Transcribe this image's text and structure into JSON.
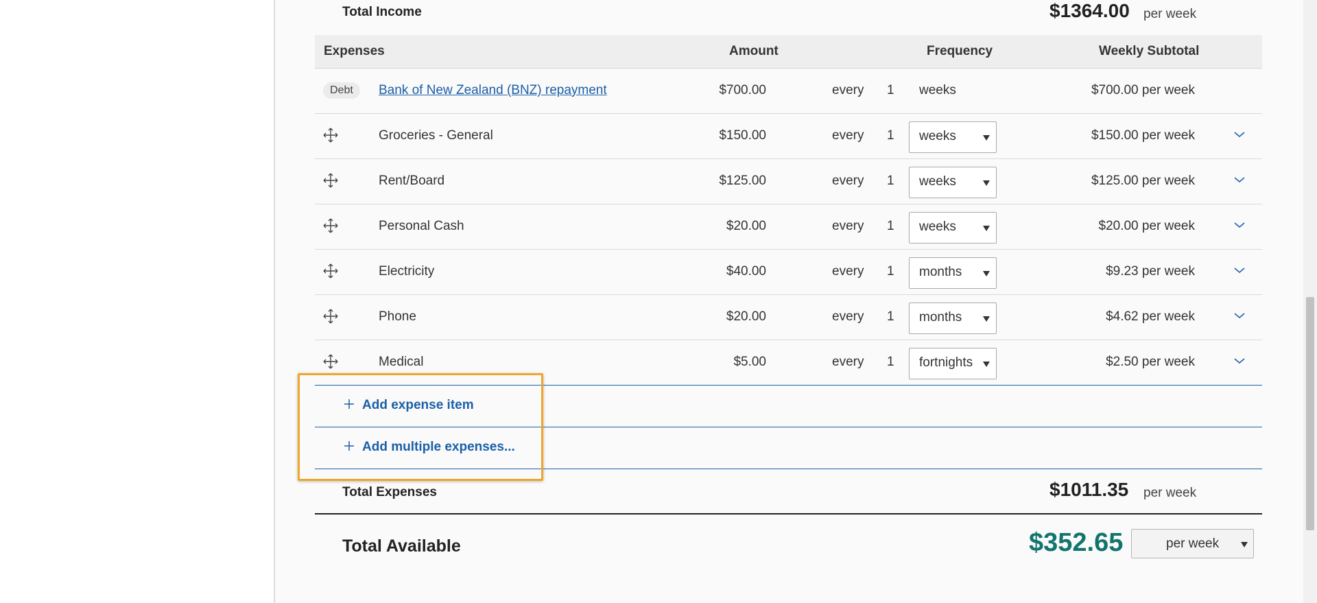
{
  "total_income": {
    "label": "Total Income",
    "amount": "$1364.00",
    "per": "per week"
  },
  "expenses_header": {
    "expenses": "Expenses",
    "amount": "Amount",
    "frequency": "Frequency",
    "weekly_subtotal": "Weekly Subtotal"
  },
  "expenses": [
    {
      "badge": "Debt",
      "name": "Bank of New Zealand (BNZ) repayment",
      "amount": "$700.00",
      "every": "every",
      "count": "1",
      "frequency": "weeks",
      "subtotal": "$700.00 per week",
      "editable": false
    },
    {
      "name": "Groceries - General",
      "amount": "$150.00",
      "every": "every",
      "count": "1",
      "frequency": "weeks",
      "subtotal": "$150.00 per week",
      "editable": true
    },
    {
      "name": "Rent/Board",
      "amount": "$125.00",
      "every": "every",
      "count": "1",
      "frequency": "weeks",
      "subtotal": "$125.00 per week",
      "editable": true
    },
    {
      "name": "Personal Cash",
      "amount": "$20.00",
      "every": "every",
      "count": "1",
      "frequency": "weeks",
      "subtotal": "$20.00 per week",
      "editable": true
    },
    {
      "name": "Electricity",
      "amount": "$40.00",
      "every": "every",
      "count": "1",
      "frequency": "months",
      "subtotal": "$9.23 per week",
      "editable": true
    },
    {
      "name": "Phone",
      "amount": "$20.00",
      "every": "every",
      "count": "1",
      "frequency": "months",
      "subtotal": "$4.62 per week",
      "editable": true
    },
    {
      "name": "Medical",
      "amount": "$5.00",
      "every": "every",
      "count": "1",
      "frequency": "fortnights",
      "subtotal": "$2.50 per week",
      "editable": true
    }
  ],
  "actions": {
    "add_expense": "Add expense item",
    "add_multiple": "Add multiple expenses..."
  },
  "total_expenses": {
    "label": "Total Expenses",
    "amount": "$1011.35",
    "per": "per week"
  },
  "total_available": {
    "label": "Total Available",
    "amount": "$352.65",
    "period": "per week"
  },
  "colors": {
    "link": "#1b5fa8",
    "available": "#12756d",
    "highlight": "#f0a52a"
  }
}
